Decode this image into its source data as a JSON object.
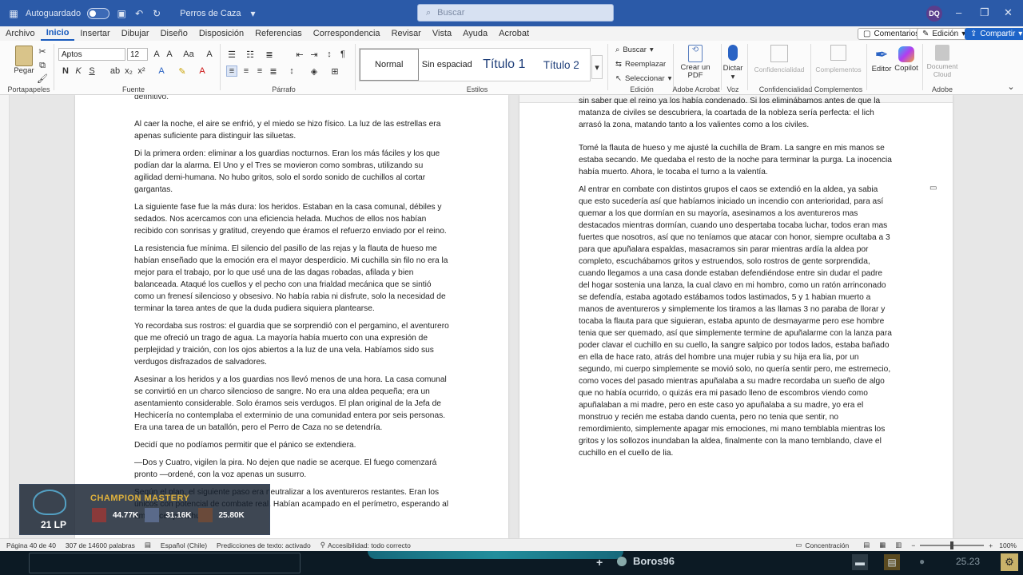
{
  "titlebar": {
    "autosave_label": "Autoguardado",
    "doc_title": "Perros de Caza",
    "search_placeholder": "Buscar",
    "user_initials": "DQ"
  },
  "menu": {
    "tabs": [
      "Archivo",
      "Inicio",
      "Insertar",
      "Dibujar",
      "Diseño",
      "Disposición",
      "Referencias",
      "Correspondencia",
      "Revisar",
      "Vista",
      "Ayuda",
      "Acrobat"
    ],
    "active": "Inicio",
    "comments_label": "Comentarios",
    "edit_mode_label": "Edición",
    "share_label": "Compartir"
  },
  "ribbon": {
    "paste_label": "Pegar",
    "font_name": "Aptos",
    "font_size": "12",
    "style_items": [
      "Normal",
      "Sin espaciad",
      "Título 1",
      "Título 2"
    ],
    "find_label": "Buscar",
    "replace_label": "Reemplazar",
    "select_label": "Seleccionar",
    "create_pdf_label": "Crear un PDF",
    "dictate_label": "Dictar",
    "confidentiality_label": "Confidencialidad",
    "addins_label": "Complementos",
    "editor_label": "Editor",
    "copilot_label": "Copilot",
    "document_cloud_label": "Document Cloud",
    "groups": [
      "Portapapeles",
      "Fuente",
      "Párrafo",
      "Estilos",
      "Edición",
      "Adobe Acrobat",
      "Voz",
      "Confidencialidad",
      "Complementos",
      "Adobe"
    ]
  },
  "document": {
    "left_top_cut": "definitivo.",
    "left_paragraphs": [
      "Al caer la noche, el aire se enfrió, y el miedo se hizo físico. La luz de las estrellas era apenas suficiente para distinguir las siluetas.",
      "Di la primera orden: eliminar a los guardias nocturnos. Eran los más fáciles y los que podían dar la alarma. El Uno y el Tres se movieron como sombras, utilizando su agilidad demi-humana. No hubo gritos, solo el sordo sonido de cuchillos al cortar gargantas.",
      "La siguiente fase fue la más dura: los heridos. Estaban en la casa comunal, débiles y sedados. Nos acercamos con una eficiencia helada. Muchos de ellos nos habían recibido con sonrisas y gratitud, creyendo que éramos el refuerzo enviado por el reino.",
      "La resistencia fue mínima. El silencio del pasillo de las rejas y la flauta de hueso me habían enseñado que la emoción era el mayor desperdicio. Mi cuchilla sin filo no era la mejor para el trabajo, por lo que usé una de las dagas robadas, afilada y bien balanceada. Ataqué los cuellos y el pecho con una frialdad mecánica que se sintió como un frenesí silencioso y obsesivo. No había rabia ni disfrute, solo la necesidad de terminar la tarea antes de que la duda pudiera siquiera plantearse.",
      "Yo recordaba sus rostros: el guardia que se sorprendió con el pergamino, el aventurero que me ofreció un trago de agua. La mayoría había muerto con una expresión de perplejidad y traición, con los ojos abiertos a la luz de una vela. Habíamos sido sus verdugos disfrazados de salvadores.",
      "Asesinar a los heridos y a los guardias nos llevó menos de una hora. La casa comunal se convirtió en un charco silencioso de sangre. No era una aldea pequeña; era un asentamiento considerable. Solo éramos seis verdugos. El plan original de la Jefa de Hechicería no contemplaba el exterminio de una comunidad entera por seis personas. Era una tarea de un batallón, pero el Perro de Caza no se detendría.",
      "Decidí que no podíamos permitir que el pánico se extendiera.",
      "—Dos y Cuatro, vigilen la pira. No dejen que nadie se acerque. El fuego comenzará pronto —ordené, con la voz apenas un susurro.",
      "Según el plan, el siguiente paso era neutralizar a los aventureros restantes. Eran los únicos con potencial de combate real. Habían acampado en el perímetro, esperando al amanecer para huir."
    ],
    "right_top_cut": "sin saber que el reino ya los había condenado. Si los eliminábamos antes de que la matanza de civiles se descubriera, la coartada de la nobleza sería perfecta: el lich arrasó la zona, matando tanto a los valientes como a los civiles.",
    "right_paragraphs": [
      "Tomé la flauta de hueso y me ajusté la cuchilla de Bram. La sangre en mis manos se estaba secando. Me quedaba el resto de la noche para terminar la purga. La inocencia había muerto. Ahora, le tocaba el turno a la valentía.",
      "Al entrar en combate con distintos grupos el caos se extendió en la aldea, ya sabia que esto sucedería así que habíamos iniciado un incendio con anterioridad, para así quemar a los que dormían en su mayoría, asesinamos a los aventureros mas destacados mientras dormían, cuando uno despertaba tocaba luchar, todos eran mas fuertes que nosotros, así que no teníamos que atacar con honor, siempre ocultaba a 3 para que apuñalara espaldas, masacramos sin parar mientras ardía la aldea por completo, escuchábamos gritos y estruendos, solo rostros de gente sorprendida, cuando llegamos a una casa donde estaban defendiéndose entre sin dudar el padre del hogar sostenia una lanza, la cual clavo en mi hombro, como un ratón arrinconado se defendía, estaba agotado estábamos todos lastimados, 5 y 1 habian muerto a manos de aventureros y simplemente los tiramos a las llamas 3 no paraba de llorar y tocaba la flauta para que siguieran, estaba apunto de desmayarme pero ese hombre tenia que ser quemado, así que simplemente termine de apuñalarme con la lanza para poder clavar el cuchillo en su cuello, la sangre salpico por todos lados, estaba bañado en ella de hace rato, atrás del hombre una mujer rubia y su hija era lia, por un segundo, mi cuerpo simplemente se movió solo, no quería sentir pero, me estremecio, como voces del pasado mientras apuñalaba a su madre recordaba un sueño de algo que no había ocurrido, o quizás era mi pasado lleno de escombros viendo como apuñalaban a mi madre, pero en este caso yo apuñalaba a su madre, yo era el monstruo y recién me estaba dando cuenta, pero no tenia que sentir, no remordimiento, simplemente apagar mis emociones, mi mano temblabla mientras los gritos y los sollozos inundaban la aldea, finalmente con la mano temblando, clave el cuchillo en el cuello de lia."
    ]
  },
  "overlay": {
    "title": "CHAMPION MASTERY",
    "rank": "21 LP",
    "scores": [
      "44.77K",
      "31.16K",
      "25.80K"
    ]
  },
  "status": {
    "page": "Página 40 de 40",
    "words": "307 de 14600 palabras",
    "language": "Español (Chile)",
    "predictions": "Predicciones de texto: activado",
    "accessibility": "Accesibilidad: todo correcto",
    "focus": "Concentración",
    "zoom": "100%"
  },
  "taskbar": {
    "player_name": "Boros96",
    "clock": "25.23"
  }
}
